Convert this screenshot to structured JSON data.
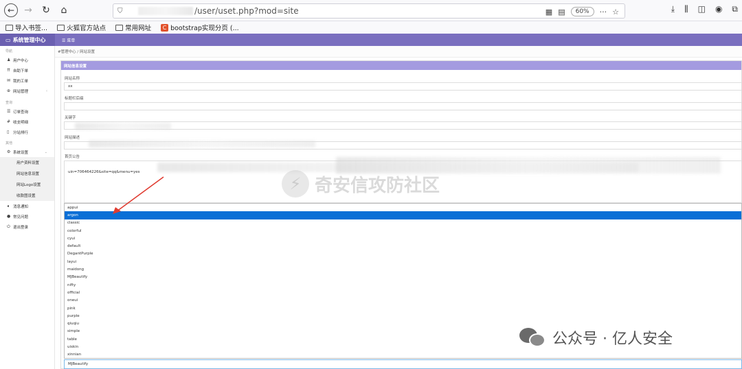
{
  "browser": {
    "url_text": "/user/uset.php?mod=site",
    "zoom": "60%",
    "bookmarks": [
      "导入书签...",
      "火狐官方站点",
      "常用网址",
      "bootstrap实现分页 (..."
    ]
  },
  "admin": {
    "brand": "系统管理中心",
    "menu_label": "☰ 菜单"
  },
  "sidebar": {
    "groups": [
      {
        "title": "导航",
        "items": [
          {
            "label": "用户中心",
            "icon": "user-icon"
          },
          {
            "label": "自助下单",
            "icon": "cart-icon"
          },
          {
            "label": "我的工单",
            "icon": "ticket-icon"
          },
          {
            "label": "网站管理",
            "icon": "globe-icon",
            "chevron": "‹"
          }
        ]
      },
      {
        "title": "查询",
        "items": [
          {
            "label": "订单查询",
            "icon": "list-icon"
          },
          {
            "label": "收支明细",
            "icon": "hash-icon"
          },
          {
            "label": "分站排行",
            "icon": "chart-icon"
          }
        ]
      },
      {
        "title": "其他",
        "items": [
          {
            "label": "系统设置",
            "icon": "gear-icon",
            "chevron": "⌄"
          }
        ]
      }
    ],
    "sub_items": [
      "用户资料设置",
      "网站信息设置",
      "网站Logo设置",
      "收款图设置"
    ],
    "bottom_items": [
      {
        "label": "消息通知",
        "icon": "bell-icon"
      },
      {
        "label": "常见问题",
        "icon": "question-icon"
      },
      {
        "label": "退出登录",
        "icon": "power-icon"
      }
    ]
  },
  "breadcrumb": "#管理中心  /  网站设置",
  "panel": {
    "title": "网站信息设置",
    "site_name_label": "网站名称",
    "site_name_value": "xx",
    "title_suffix_label": "标题栏后缀",
    "keywords_label": "关键字",
    "description_label": "网站描述",
    "announcement_label": "首页公告",
    "announcement_visible": "uin=706464226&site=qq&menu=yes"
  },
  "dropdown": {
    "options": [
      "appui",
      "argon",
      "classic",
      "colorful",
      "cyui",
      "default",
      "DegantPurple",
      "layui",
      "maidong",
      "MJBeautify",
      "nifty",
      "official",
      "oneui",
      "pink",
      "purple",
      "qiuqiu",
      "simple",
      "table",
      "uiskin",
      "xinnian"
    ],
    "selected_highlight": "argon",
    "current_value": "MJBeautify"
  },
  "watermarks": {
    "center": "奇安信攻防社区",
    "footer": "公众号 · 亿人安全"
  },
  "colors": {
    "admin_bar": "#7a6fbf",
    "panel_head": "#a49be0",
    "selected": "#0a6fd6",
    "arrow": "#e03c31"
  }
}
